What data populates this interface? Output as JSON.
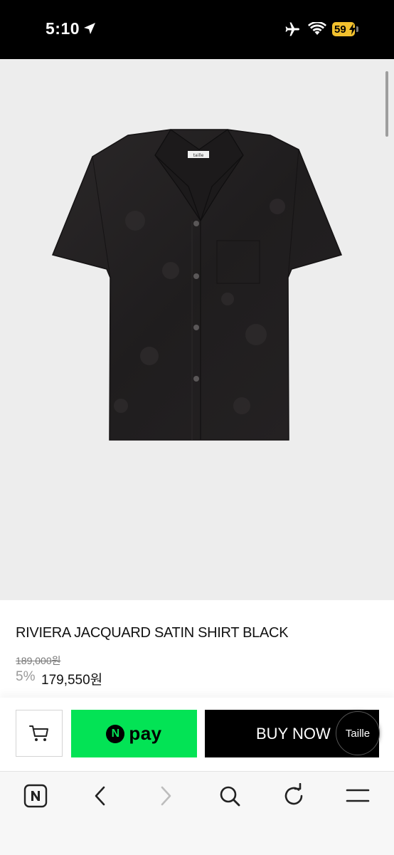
{
  "status_bar": {
    "time": "5:10",
    "battery_level": "59",
    "icons": [
      "location-arrow-icon",
      "airplane-icon",
      "wifi-icon",
      "battery-charging-icon"
    ],
    "battery_color": "#f2c12e"
  },
  "product": {
    "image": "black-short-sleeve-shirt",
    "title": "RIVIERA JACQUARD SATIN SHIRT BLACK",
    "original_price": "189,000원",
    "discount": "5%",
    "sale_price": "179,550원"
  },
  "purchase_bar": {
    "cart_icon": "cart-icon",
    "npay_badge": "N",
    "npay_label": "pay",
    "npay_color": "#03e355",
    "buy_now_label": "BUY NOW",
    "taille_label": "Taille"
  },
  "browser_toolbar": {
    "icons": [
      "naver-home-icon",
      "back-icon",
      "forward-icon",
      "search-icon",
      "refresh-icon",
      "menu-icon"
    ]
  }
}
